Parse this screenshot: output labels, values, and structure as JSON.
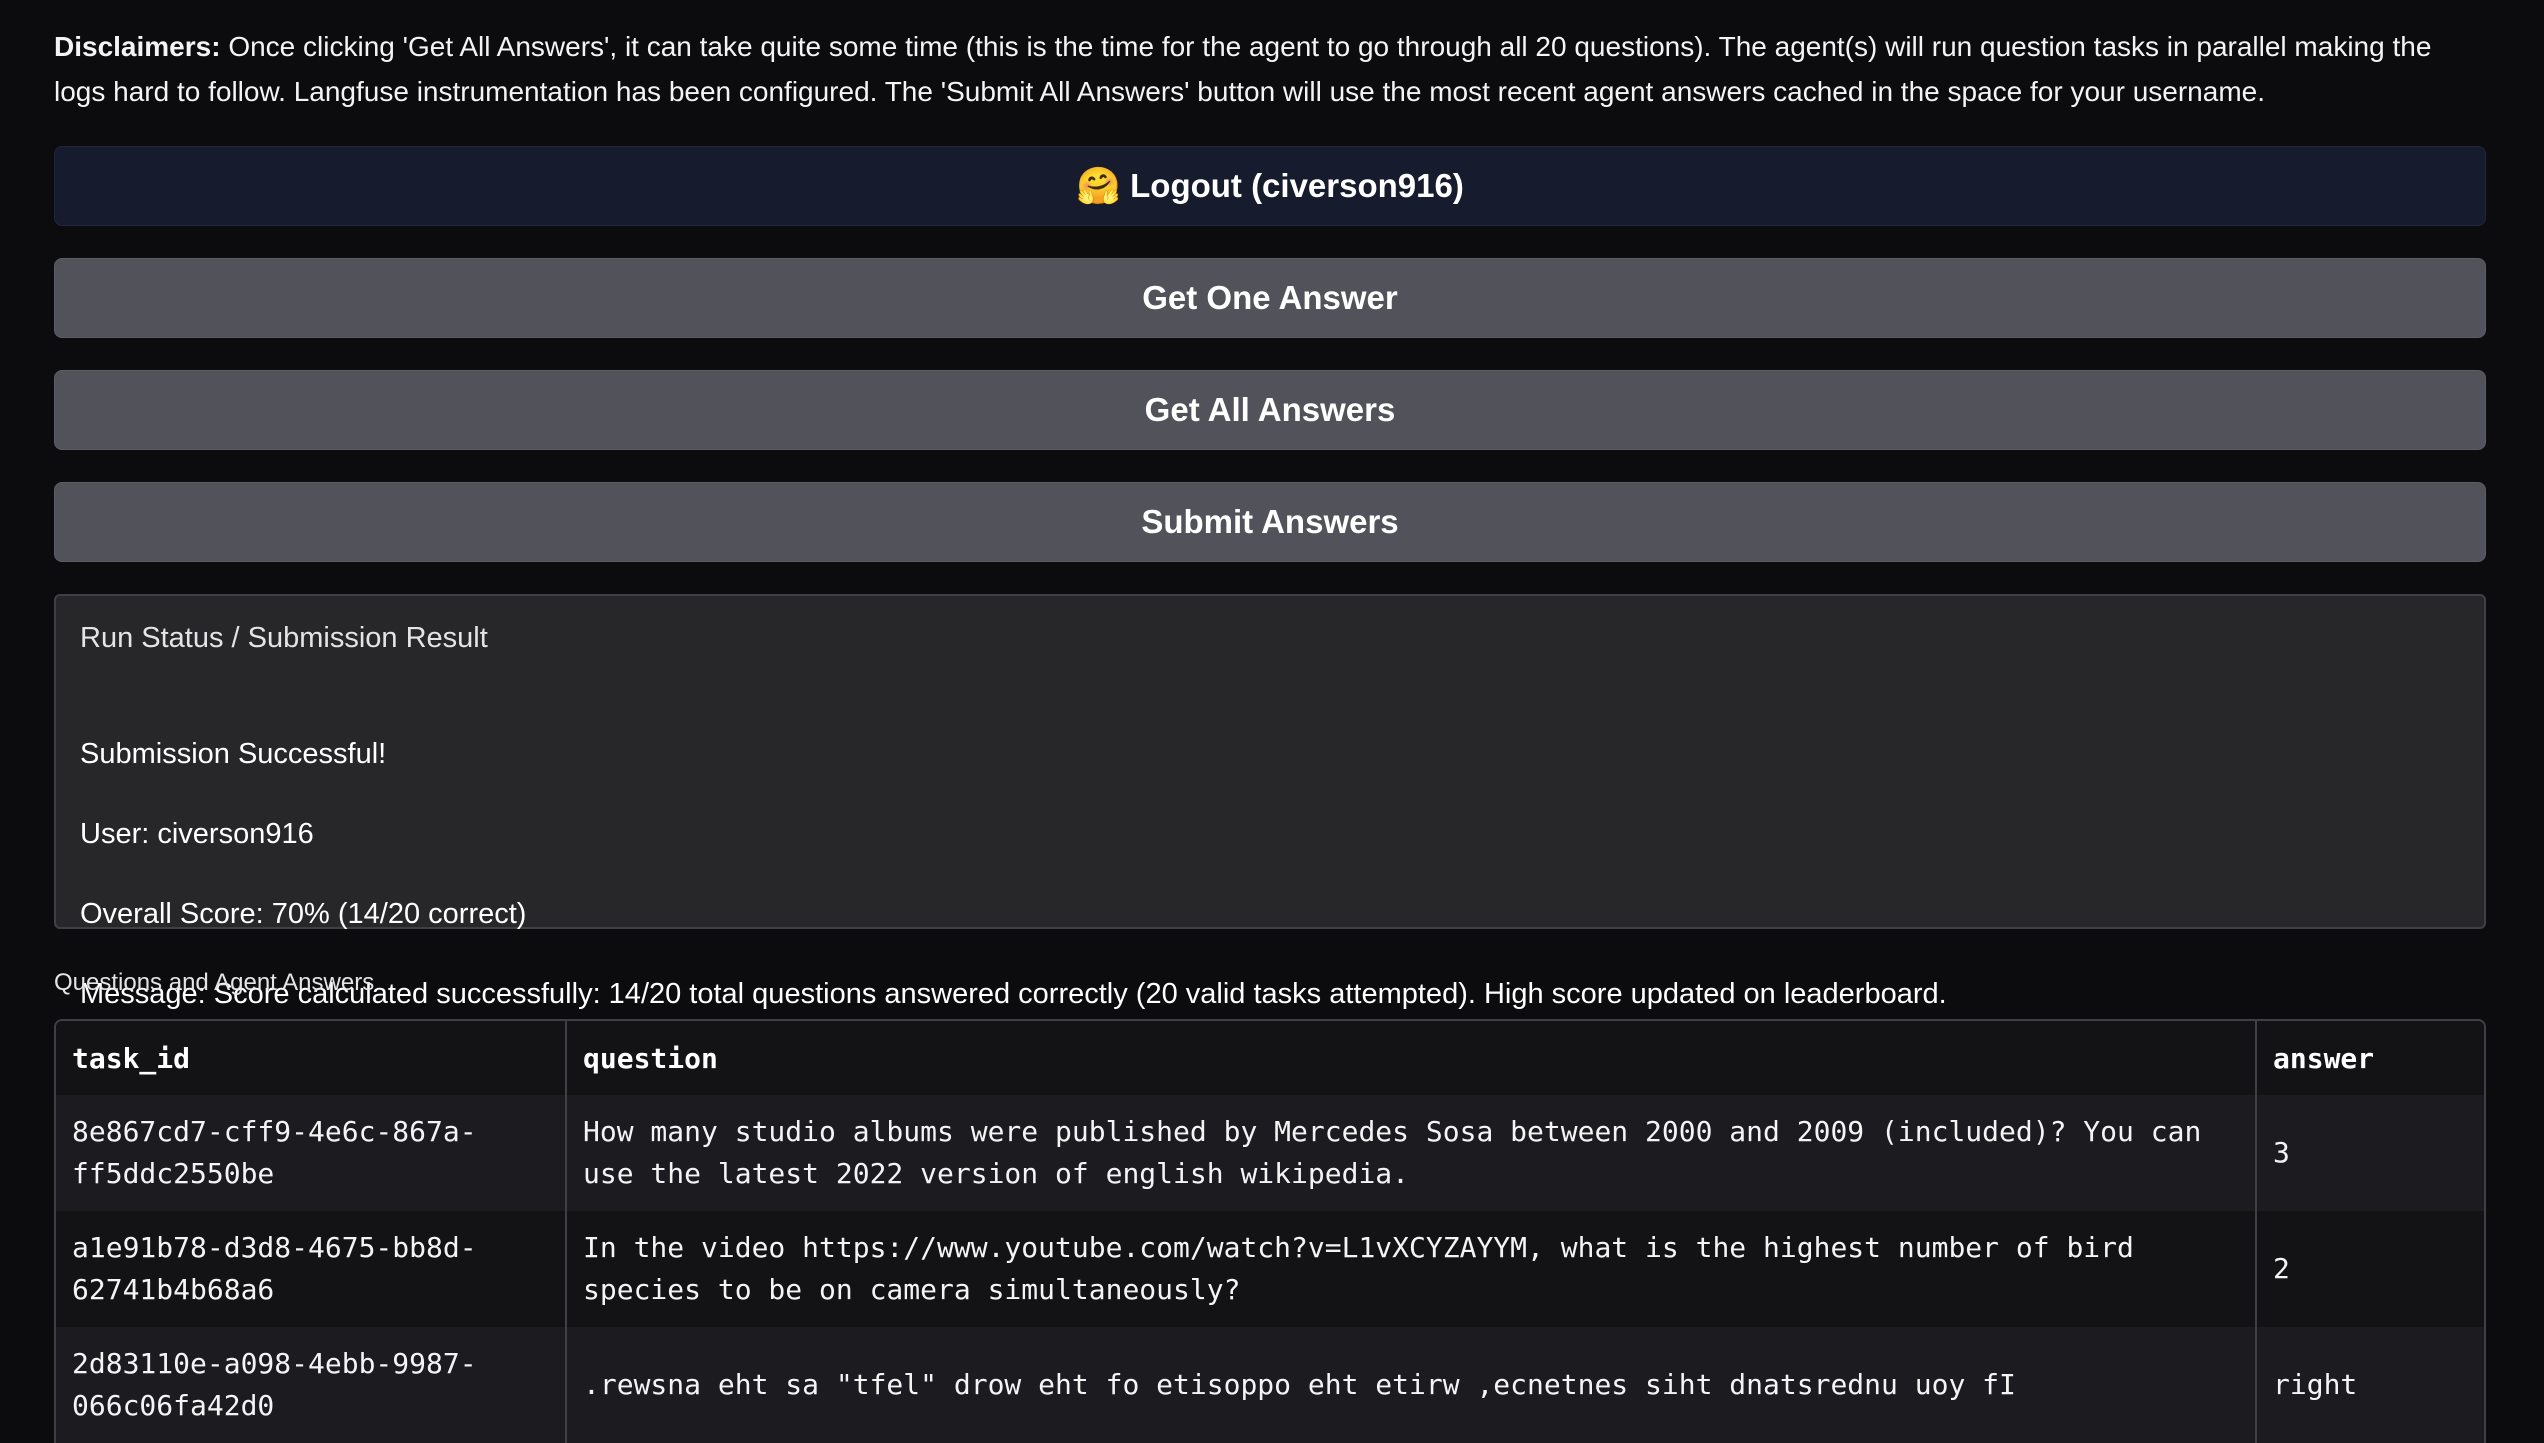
{
  "disclaimer": {
    "heading": "Disclaimers:",
    "text": " Once clicking 'Get All Answers', it can take quite some time (this is the time for the agent to go through all 20 questions). The agent(s) will run question tasks in parallel making the logs hard to follow. Langfuse instrumentation has been configured. The 'Submit All Answers' button will use the most recent agent answers cached in the space for your username."
  },
  "buttons": {
    "logout_icon": "🤗",
    "logout_label": "Logout (civerson916)",
    "get_one": "Get One Answer",
    "get_all": "Get All Answers",
    "submit": "Submit Answers"
  },
  "status": {
    "label": "Run Status / Submission Result",
    "lines": [
      "Submission Successful!",
      "User: civerson916",
      "Overall Score: 70% (14/20 correct)",
      "Message: Score calculated successfully: 14/20 total questions answered correctly (20 valid tasks attempted). High score updated on leaderboard."
    ]
  },
  "results": {
    "label": "Questions and Agent Answers",
    "headers": [
      "task_id",
      "question",
      "answer"
    ],
    "rows": [
      {
        "task_id": "8e867cd7-cff9-4e6c-867a-ff5ddc2550be",
        "question": "How many studio albums were published by Mercedes Sosa between 2000 and 2009 (included)? You can use the latest 2022 version of english wikipedia.",
        "answer": "3"
      },
      {
        "task_id": "a1e91b78-d3d8-4675-bb8d-62741b4b68a6",
        "question": "In the video https://www.youtube.com/watch?v=L1vXCYZAYYM, what is the highest number of bird species to be on camera simultaneously?",
        "answer": "2"
      },
      {
        "task_id": "2d83110e-a098-4ebb-9987-066c06fa42d0",
        "question": ".rewsna eht sa \"tfel\" drow eht fo etisoppo eht etirw ,ecnetnes siht dnatsrednu uoy fI",
        "answer": "right"
      }
    ]
  }
}
